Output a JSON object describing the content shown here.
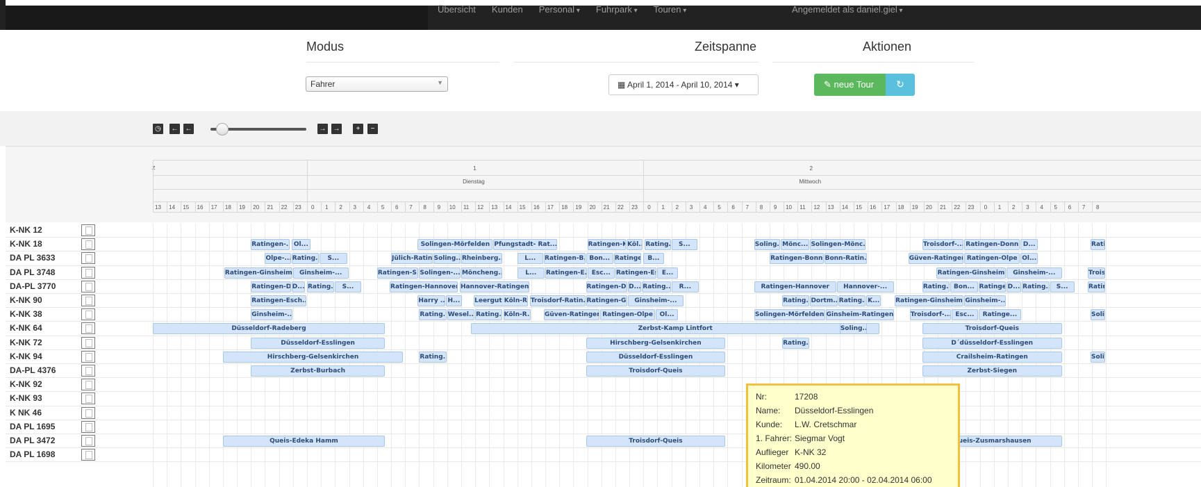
{
  "nav": {
    "items": [
      {
        "label": "Übersicht",
        "caret": false
      },
      {
        "label": "Kunden",
        "caret": false
      },
      {
        "label": "Personal",
        "caret": true
      },
      {
        "label": "Fuhrpark",
        "caret": true
      },
      {
        "label": "Touren",
        "caret": true
      }
    ],
    "user": "Angemeldet als daniel.giel"
  },
  "header": {
    "modus": "Modus",
    "zeitspanne": "Zeitspanne",
    "aktionen": "Aktionen",
    "mode_value": "Fahrer",
    "date_range": "April 1, 2014 - April 10, 2014",
    "new_tour": "neue Tour"
  },
  "toolbar": {
    "slider_value": 0.12
  },
  "timeline": {
    "unit_label": "z",
    "days": [
      {
        "num": "1",
        "name": "Dienstag"
      },
      {
        "num": "2",
        "name": "Mittwoch"
      }
    ],
    "hours": [
      "13",
      "14",
      "15",
      "16",
      "17",
      "18",
      "19",
      "20",
      "21",
      "22",
      "23",
      "0",
      "1",
      "2",
      "3",
      "4",
      "5",
      "6",
      "7",
      "8",
      "9",
      "10",
      "11",
      "12",
      "13",
      "14",
      "15",
      "16",
      "17",
      "18",
      "19",
      "20",
      "21",
      "22",
      "23",
      "0",
      "1",
      "2",
      "3",
      "4",
      "5",
      "6",
      "7",
      "8",
      "9",
      "10",
      "11",
      "12",
      "13",
      "14",
      "15",
      "16",
      "17",
      "18",
      "19",
      "20",
      "21",
      "22",
      "23",
      "0",
      "1",
      "2",
      "3",
      "4",
      "5",
      "6",
      "7",
      "8"
    ]
  },
  "rows": [
    {
      "label": "K-NK 12",
      "bars": []
    },
    {
      "label": "K-NK 18",
      "bars": [
        {
          "text": "Ratingen-...",
          "s": 20.0,
          "e": 22.8
        },
        {
          "text": "Ol...",
          "s": 22.9,
          "e": 24.3
        },
        {
          "text": "Solingen-Mörfelden",
          "s": 31.9,
          "e": 37.3
        },
        {
          "text": "Pfungstadt- Rat...",
          "s": 37.3,
          "e": 41.9
        },
        {
          "text": "Ratingen-K...",
          "s": 44.0,
          "e": 46.8
        },
        {
          "text": "Köl...",
          "s": 46.8,
          "e": 48.0
        },
        {
          "text": "Rating...",
          "s": 48.1,
          "e": 50.0
        },
        {
          "text": "S...",
          "s": 50.0,
          "e": 51.9
        },
        {
          "text": "Soling...",
          "s": 55.9,
          "e": 57.8
        },
        {
          "text": "Mönc...",
          "s": 57.8,
          "e": 59.9
        },
        {
          "text": "Solingen-Mönc...",
          "s": 59.9,
          "e": 63.9
        },
        {
          "text": "Troisdorf-...",
          "s": 67.9,
          "e": 70.9
        },
        {
          "text": "Ratingen-Donn",
          "s": 70.9,
          "e": 74.9
        },
        {
          "text": "D...",
          "s": 74.9,
          "e": 76.2
        },
        {
          "text": "Rati",
          "s": 79.9,
          "e": 81.0
        }
      ]
    },
    {
      "label": "DA PL 3633",
      "bars": [
        {
          "text": "Olpe-...",
          "s": 21.0,
          "e": 22.9
        },
        {
          "text": "Rating...",
          "s": 22.9,
          "e": 24.9
        },
        {
          "text": "S...",
          "s": 24.9,
          "e": 26.9
        },
        {
          "text": "Jülich-Ratingen",
          "s": 30.0,
          "e": 33.0
        },
        {
          "text": "Soling...",
          "s": 33.0,
          "e": 35.0
        },
        {
          "text": "Rheinberg...",
          "s": 35.0,
          "e": 38.0
        },
        {
          "text": "L...",
          "s": 39.0,
          "e": 40.9
        },
        {
          "text": "Ratingen-B...",
          "s": 40.9,
          "e": 43.9
        },
        {
          "text": "Bon...",
          "s": 43.9,
          "e": 45.9
        },
        {
          "text": "Ratinge...",
          "s": 45.9,
          "e": 47.9
        },
        {
          "text": "B...",
          "s": 48.0,
          "e": 49.5
        },
        {
          "text": "Ratingen-Bonn",
          "s": 57.0,
          "e": 60.9
        },
        {
          "text": "Bonn-Ratin...",
          "s": 60.9,
          "e": 64.0
        },
        {
          "text": "Güven-Ratingen",
          "s": 66.9,
          "e": 70.9
        },
        {
          "text": "Ratingen-Olpe",
          "s": 70.9,
          "e": 74.9
        },
        {
          "text": "Ol...",
          "s": 74.9,
          "e": 76.2
        }
      ]
    },
    {
      "label": "DA PL 3748",
      "bars": [
        {
          "text": "Ratingen-Ginsheim",
          "s": 18.1,
          "e": 23.0
        },
        {
          "text": "Ginsheim-...",
          "s": 23.0,
          "e": 27.0
        },
        {
          "text": "Ratingen-S...",
          "s": 29.0,
          "e": 32.0
        },
        {
          "text": "Solingen-...",
          "s": 32.0,
          "e": 35.0
        },
        {
          "text": "Möncheng...",
          "s": 35.0,
          "e": 38.0
        },
        {
          "text": "L...",
          "s": 39.0,
          "e": 41.0
        },
        {
          "text": "Ratingen-E...",
          "s": 41.0,
          "e": 44.0
        },
        {
          "text": "Esc...",
          "s": 44.0,
          "e": 46.0
        },
        {
          "text": "Ratingen-Esc...",
          "s": 46.0,
          "e": 49.0
        },
        {
          "text": "E...",
          "s": 49.0,
          "e": 50.5
        },
        {
          "text": "Ratingen-Ginsheim",
          "s": 68.9,
          "e": 73.9
        },
        {
          "text": "Ginsheim-...",
          "s": 73.9,
          "e": 77.9
        },
        {
          "text": "Troisdorf-Bo",
          "s": 79.7,
          "e": 81.0
        }
      ]
    },
    {
      "label": "DA-PL 3770",
      "bars": [
        {
          "text": "Ratingen-D...",
          "s": 20.0,
          "e": 22.9
        },
        {
          "text": "D...",
          "s": 22.9,
          "e": 23.9
        },
        {
          "text": "Rating...",
          "s": 24.0,
          "e": 26.0
        },
        {
          "text": "S...",
          "s": 26.0,
          "e": 27.9
        },
        {
          "text": "Ratingen-Hannover",
          "s": 29.9,
          "e": 34.8
        },
        {
          "text": "Hannover-Ratingen",
          "s": 34.9,
          "e": 39.9
        },
        {
          "text": "Ratingen-D...",
          "s": 43.9,
          "e": 46.9
        },
        {
          "text": "D...",
          "s": 46.9,
          "e": 47.9
        },
        {
          "text": "Rating...",
          "s": 47.9,
          "e": 50.0
        },
        {
          "text": "R...",
          "s": 50.0,
          "e": 52.0
        },
        {
          "text": "Ratingen-Hannover",
          "s": 55.9,
          "e": 61.8
        },
        {
          "text": "Hannover-...",
          "s": 61.8,
          "e": 65.9
        },
        {
          "text": "Rating...",
          "s": 67.9,
          "e": 69.9
        },
        {
          "text": "Bon...",
          "s": 69.9,
          "e": 71.9
        },
        {
          "text": "Ratinge...",
          "s": 71.9,
          "e": 73.9
        },
        {
          "text": "D...",
          "s": 73.9,
          "e": 75.0
        },
        {
          "text": "Rating...",
          "s": 75.0,
          "e": 77.0
        },
        {
          "text": "S...",
          "s": 77.0,
          "e": 78.8
        },
        {
          "text": "Ratingen-H",
          "s": 79.7,
          "e": 81.0
        }
      ]
    },
    {
      "label": "K-NK 90",
      "bars": [
        {
          "text": "Ratingen-Esch...",
          "s": 20.0,
          "e": 24.0
        },
        {
          "text": "Harry ...",
          "s": 31.9,
          "e": 33.9
        },
        {
          "text": "H...",
          "s": 33.9,
          "e": 35.1
        },
        {
          "text": "Leergut Köln-R...",
          "s": 35.9,
          "e": 39.8
        },
        {
          "text": "Troisdorf-Ratin...",
          "s": 39.9,
          "e": 43.9
        },
        {
          "text": "Ratingen-Gins...",
          "s": 43.9,
          "e": 46.9
        },
        {
          "text": "Ginsheim-...",
          "s": 46.9,
          "e": 50.9
        },
        {
          "text": "Rating...",
          "s": 57.9,
          "e": 59.9
        },
        {
          "text": "Dortm...",
          "s": 59.9,
          "e": 61.9
        },
        {
          "text": "Rating...",
          "s": 61.9,
          "e": 63.9
        },
        {
          "text": "K...",
          "s": 63.9,
          "e": 65.0
        },
        {
          "text": "Ratingen-Ginsheim",
          "s": 65.9,
          "e": 70.9
        },
        {
          "text": "Ginsheim-...",
          "s": 70.9,
          "e": 73.9
        }
      ]
    },
    {
      "label": "K-NK 38",
      "bars": [
        {
          "text": "Ginsheim-...",
          "s": 20.0,
          "e": 23.0
        },
        {
          "text": "Rating...",
          "s": 32.0,
          "e": 34.0
        },
        {
          "text": "Wesel...",
          "s": 34.0,
          "e": 36.0
        },
        {
          "text": "Rating...",
          "s": 36.0,
          "e": 38.0
        },
        {
          "text": "Köln-R...",
          "s": 38.0,
          "e": 40.0
        },
        {
          "text": "Güven-Ratingen",
          "s": 40.9,
          "e": 44.9
        },
        {
          "text": "Ratingen-Olpe",
          "s": 44.9,
          "e": 48.9
        },
        {
          "text": "Ol...",
          "s": 48.9,
          "e": 50.5
        },
        {
          "text": "Solingen-Mörfelden",
          "s": 55.9,
          "e": 61.0
        },
        {
          "text": "Ginsheim-Ratingen",
          "s": 61.0,
          "e": 65.9
        },
        {
          "text": "Troisdorf-...",
          "s": 67.0,
          "e": 70.0
        },
        {
          "text": "Esc...",
          "s": 70.0,
          "e": 71.9
        },
        {
          "text": "Ratinge...",
          "s": 71.9,
          "e": 75.0
        },
        {
          "text": "Solinge",
          "s": 79.9,
          "e": 81.0
        }
      ]
    },
    {
      "label": "K-NK 64",
      "bars": [
        {
          "text": "Düsseldorf-Radeberg",
          "s": 13.0,
          "e": 29.6
        },
        {
          "text": "Zerbst-Kamp Lintfort",
          "s": 35.7,
          "e": 64.9
        },
        {
          "text": "Soling...",
          "s": 62.0,
          "e": 64.0
        },
        {
          "text": "Troisdorf-Queis",
          "s": 67.9,
          "e": 77.9
        }
      ]
    },
    {
      "label": "K-NK 72",
      "bars": [
        {
          "text": "Düsseldorf-Esslingen",
          "s": 20.0,
          "e": 29.6
        },
        {
          "text": "Hirschberg-Gelsenkirchen",
          "s": 43.9,
          "e": 53.9
        },
        {
          "text": "Rating...",
          "s": 57.9,
          "e": 59.9
        },
        {
          "text": "D´düsseldorf-Esslingen",
          "s": 67.9,
          "e": 77.9
        }
      ]
    },
    {
      "label": "K-NK 94",
      "bars": [
        {
          "text": "Hirschberg-Gelsenkirchen",
          "s": 18.0,
          "e": 30.9
        },
        {
          "text": "Rating...",
          "s": 32.0,
          "e": 34.0
        },
        {
          "text": "Düsseldorf-Esslingen",
          "s": 43.9,
          "e": 53.9
        },
        {
          "text": "Crailsheim-Ratingen",
          "s": 67.9,
          "e": 77.9
        },
        {
          "text": "Solinger",
          "s": 79.9,
          "e": 81.0
        }
      ]
    },
    {
      "label": "DA-PL 4376",
      "bars": [
        {
          "text": "Zerbst-Burbach",
          "s": 20.0,
          "e": 29.6
        },
        {
          "text": "Troisdorf-Queis",
          "s": 43.9,
          "e": 53.9
        },
        {
          "text": "Zerbst-Siegen",
          "s": 67.9,
          "e": 77.9
        }
      ]
    },
    {
      "label": "K-NK 92",
      "bars": []
    },
    {
      "label": "K-NK 93",
      "bars": []
    },
    {
      "label": "K NK 46",
      "bars": []
    },
    {
      "label": "DA PL 1695",
      "bars": []
    },
    {
      "label": "DA PL 3472",
      "bars": [
        {
          "text": "Queis-Edeka Hamm",
          "s": 18.0,
          "e": 29.6
        },
        {
          "text": "Troisdorf-Queis",
          "s": 43.9,
          "e": 53.9
        },
        {
          "text": "Queis-Zusmarshausen",
          "s": 67.9,
          "e": 77.9
        }
      ]
    },
    {
      "label": "DA PL 1698",
      "bars": []
    }
  ],
  "tooltip": {
    "nr_label": "Nr:",
    "nr": "17208",
    "name_label": "Name:",
    "name": "Düsseldorf-Esslingen",
    "kunde_label": "Kunde:",
    "kunde": "L.W. Cretschmar",
    "fahrer_label": "1. Fahrer:",
    "fahrer": "Siegmar Vogt",
    "auflieger_label": "Auflieger",
    "auflieger": "K-NK 32",
    "km_label": "Kilometer",
    "km": "490.00",
    "zeitraum_label": "Zeitraum:",
    "zeitraum": "01.04.2014 20:00 - 02.04.2014 06:00"
  }
}
